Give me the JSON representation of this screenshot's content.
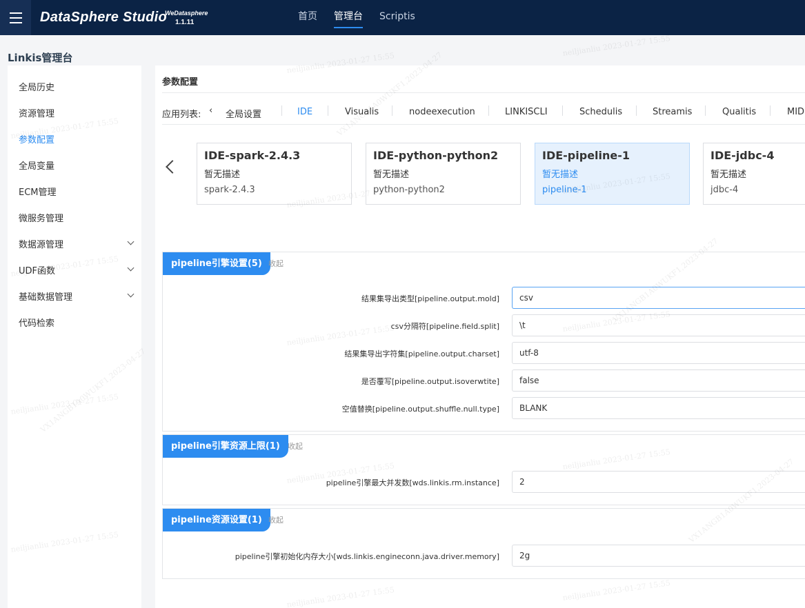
{
  "header": {
    "logo_text": "DataSphere Studio",
    "logo_sub": "WeDatasphere",
    "version": "1.1.11",
    "nav": [
      {
        "label": "首页"
      },
      {
        "label": "管理台"
      },
      {
        "label": "Scriptis"
      }
    ],
    "active_nav": "管理台"
  },
  "sidebar": {
    "title": "Linkis管理台",
    "items": [
      {
        "label": "全局历史"
      },
      {
        "label": "资源管理"
      },
      {
        "label": "参数配置"
      },
      {
        "label": "全局变量"
      },
      {
        "label": "ECM管理"
      },
      {
        "label": "微服务管理"
      },
      {
        "label": "数据源管理"
      },
      {
        "label": "UDF函数"
      },
      {
        "label": "基础数据管理"
      },
      {
        "label": "代码检索"
      }
    ],
    "active_item": "参数配置"
  },
  "main": {
    "title": "参数配置",
    "app_list_label": "应用列表:",
    "tabs": [
      {
        "label": "全局设置"
      },
      {
        "label": "IDE"
      },
      {
        "label": "Visualis"
      },
      {
        "label": "nodeexecution"
      },
      {
        "label": "LINKISCLI"
      },
      {
        "label": "Schedulis"
      },
      {
        "label": "Streamis"
      },
      {
        "label": "Qualitis"
      },
      {
        "label": "MID"
      }
    ],
    "active_tab": "IDE",
    "engines": [
      {
        "title": "IDE-spark-2.4.3",
        "desc": "暂无描述",
        "version": "spark-2.4.3"
      },
      {
        "title": "IDE-python-python2",
        "desc": "暂无描述",
        "version": "python-python2"
      },
      {
        "title": "IDE-pipeline-1",
        "desc": "暂无描述",
        "version": "pipeline-1"
      },
      {
        "title": "IDE-jdbc-4",
        "desc": "暂无描述",
        "version": "jdbc-4"
      }
    ],
    "active_engine": "IDE-pipeline-1",
    "sections": [
      {
        "title": "pipeline引擎设置(5)",
        "collapse_label": "收起",
        "rows": [
          {
            "label": "结果集导出类型[pipeline.output.mold]",
            "value": "csv"
          },
          {
            "label": "csv分隔符[pipeline.field.split]",
            "value": "\\t"
          },
          {
            "label": "结果集导出字符集[pipeline.output.charset]",
            "value": "utf-8"
          },
          {
            "label": "是否覆写[pipeline.output.isoverwtite]",
            "value": "false"
          },
          {
            "label": "空值替换[pipeline.output.shuffle.null.type]",
            "value": "BLANK"
          }
        ]
      },
      {
        "title": "pipeline引擎资源上限(1)",
        "collapse_label": "收起",
        "rows": [
          {
            "label": "pipeline引擎最大并发数[wds.linkis.rm.instance]",
            "value": "2"
          }
        ]
      },
      {
        "title": "pipeline资源设置(1)",
        "collapse_label": "收起",
        "rows": [
          {
            "label": "pipeline引擎初始化内存大小[wds.linkis.engineconn.java.driver.memory]",
            "value": "2g"
          }
        ]
      }
    ]
  },
  "watermark": {
    "user_text": "neiljianliu 2023-01-27 15:55",
    "code_text": "VX1ANGB1A0WUKF1,2023-04-27"
  },
  "colors": {
    "topbar": "#0b2345",
    "accent": "#2d8cf0",
    "active_card_bg": "#e6f1fd"
  }
}
